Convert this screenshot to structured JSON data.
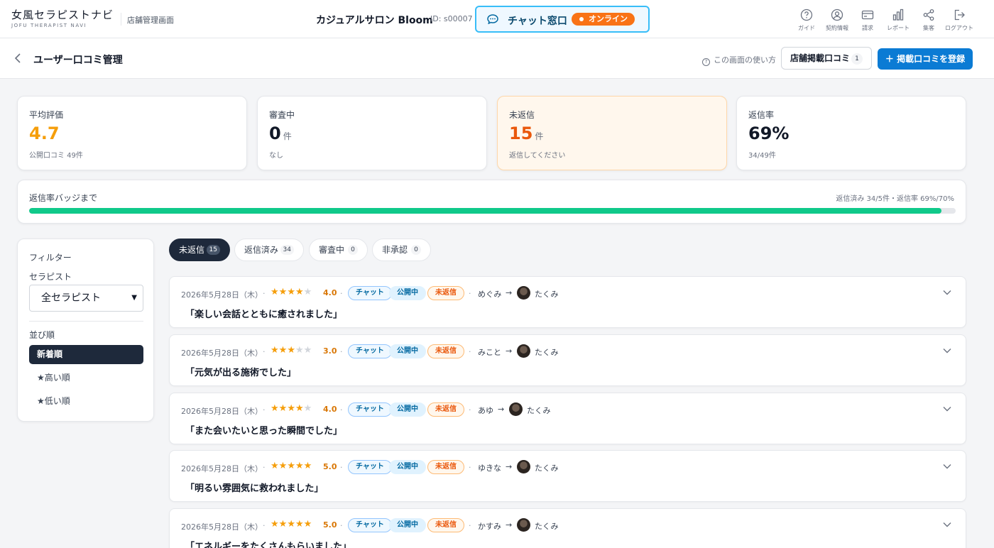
{
  "header": {
    "logo_main": "女風セラピストナビ",
    "logo_sub": "JOFU THERAPIST NAVI",
    "admin_label": "店舗管理画面",
    "shop_name": "カジュアルサロン Bloom",
    "shop_id": "ID: s00007",
    "chat_label": "チャット窓口",
    "chat_status": "オンライン",
    "nav": [
      {
        "label": "ガイド",
        "icon": "help-circle-icon"
      },
      {
        "label": "契約情報",
        "icon": "user-circle-icon"
      },
      {
        "label": "請求",
        "icon": "credit-card-icon"
      },
      {
        "label": "レポート",
        "icon": "bar-chart-icon"
      },
      {
        "label": "集客",
        "icon": "share-icon"
      },
      {
        "label": "ログアウト",
        "icon": "logout-icon"
      }
    ]
  },
  "subheader": {
    "title": "ユーザー口コミ管理",
    "howto": "この画面の使い方",
    "store_reviews_label": "店舗掲載口コミ",
    "store_reviews_count": "1",
    "register_label": "掲載口コミを登録"
  },
  "stats": [
    {
      "label": "平均評価",
      "value": "4.7",
      "unit": "",
      "sub": "公開口コミ 49件",
      "color": "#f59e0b"
    },
    {
      "label": "審査中",
      "value": "0",
      "unit": "件",
      "sub": "なし",
      "color": "#111827"
    },
    {
      "label": "未返信",
      "value": "15",
      "unit": "件",
      "sub": "返信してください",
      "color": "#ea580c"
    },
    {
      "label": "返信率",
      "value": "69%",
      "unit": "",
      "sub": "34/49件",
      "color": "#111827"
    }
  ],
  "progress": {
    "label": "返信率バッジまで",
    "meta": "返信済み 34/5件・返信率 69%/70%",
    "fill_fraction": 0.985,
    "color": "#10c98a"
  },
  "filter": {
    "title": "フィルター",
    "therapist_label": "セラピスト",
    "therapist_selected": "全セラピスト",
    "sort_label": "並び順",
    "sort_options": [
      "新着順",
      "★高い順",
      "★低い順"
    ]
  },
  "tabs": [
    {
      "label": "未返信",
      "count": "15"
    },
    {
      "label": "返信済み",
      "count": "34"
    },
    {
      "label": "審査中",
      "count": "0"
    },
    {
      "label": "非承認",
      "count": "0"
    }
  ],
  "badges": {
    "channel": "チャット",
    "public": "公開中",
    "unreplied": "未返信"
  },
  "reviews": [
    {
      "date": "2026年5月28日（木）",
      "rating": 4,
      "score": "4.0",
      "user": "めぐみ",
      "therapist": "たくみ",
      "title": "「楽しい会話とともに癒されました」"
    },
    {
      "date": "2026年5月28日（木）",
      "rating": 3,
      "score": "3.0",
      "user": "みこと",
      "therapist": "たくみ",
      "title": "「元気が出る施術でした」"
    },
    {
      "date": "2026年5月28日（木）",
      "rating": 4,
      "score": "4.0",
      "user": "あゆ",
      "therapist": "たくみ",
      "title": "「また会いたいと思った瞬間でした」"
    },
    {
      "date": "2026年5月28日（木）",
      "rating": 5,
      "score": "5.0",
      "user": "ゆきな",
      "therapist": "たくみ",
      "title": "「明るい雰囲気に救われました」"
    },
    {
      "date": "2026年5月28日（木）",
      "rating": 5,
      "score": "5.0",
      "user": "かすみ",
      "therapist": "たくみ",
      "title": "「エネルギーをたくさんもらいました」"
    }
  ]
}
